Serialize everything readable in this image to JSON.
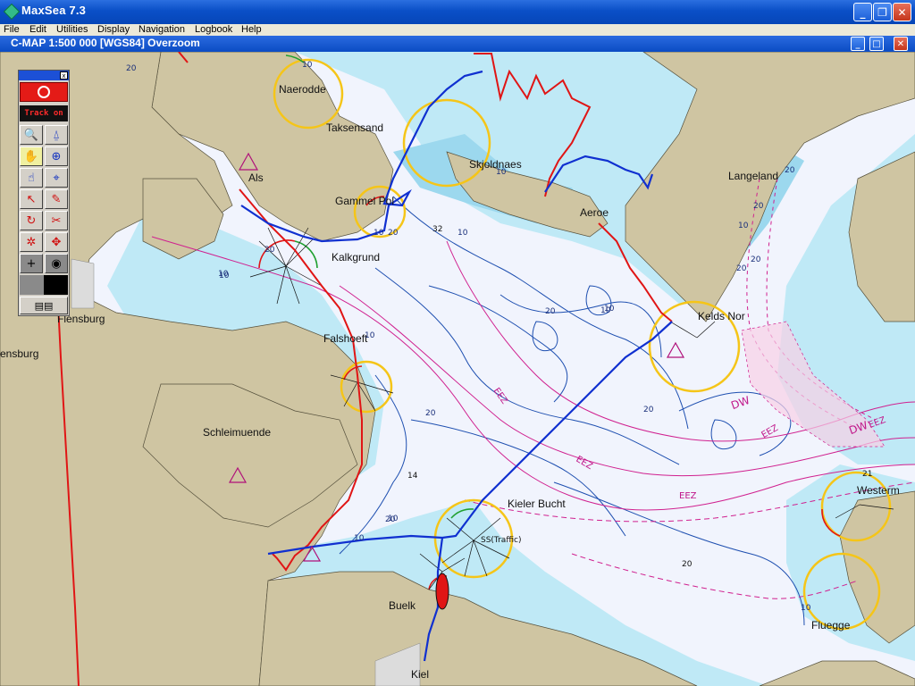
{
  "window": {
    "title": "MaxSea 7.3",
    "buttons": {
      "minimize": "_",
      "maximize": "❐",
      "close": "✕"
    }
  },
  "menu": [
    "File",
    "Edit",
    "Utilities",
    "Display",
    "Navigation",
    "Logbook",
    "Help"
  ],
  "chart_window": {
    "title": "C-MAP  1:500 000 [WGS84]    Overzoom",
    "buttons": {
      "minimize": "_",
      "maximize": "□",
      "close": "✕"
    }
  },
  "places": {
    "naerodde": "Naerodde",
    "taksensand": "Taksensand",
    "skjoldnaes": "Skjoldnaes",
    "als": "Als",
    "gammel_pol": "Gammel Pol",
    "aeroe": "Aeroe",
    "langeland": "Langeland",
    "kalkgrund": "Kalkgrund",
    "flensburg": "Flensburg",
    "flensburg_2": "ensburg",
    "falshoeft": "Falshoeft",
    "keldsnor": "Kelds Nor",
    "schleimuende": "Schleimuende",
    "kieler_bucht": "Kieler Bucht",
    "westermarkelsdorf": "Westerm",
    "buelk": "Buelk",
    "fluegge": "Fluegge",
    "kiel": "Kiel",
    "traffic": "SS(Traffic)"
  },
  "depths": [
    "20",
    "10",
    "10",
    "10",
    "20",
    "32",
    "10",
    "20",
    "20",
    "10",
    "20",
    "10",
    "20",
    "10",
    "20",
    "20",
    "10",
    "20",
    "10",
    "14",
    "20",
    "10",
    "10",
    "20",
    "10",
    "20",
    "21",
    "10"
  ],
  "zones": {
    "eez1": "EEZ",
    "eez2": "EEZ",
    "eez3": "EEZ",
    "eez4": "EEZ",
    "eez5": "EEZ",
    "dw1": "DW",
    "dw2": "DW"
  },
  "toolbox": {
    "close": "x",
    "track_label": "Track on",
    "tools": [
      {
        "name": "zoom-tool",
        "icon": "zoom-icon",
        "glyph": "🔍"
      },
      {
        "name": "compass-tool",
        "icon": "compass-icon",
        "glyph": "⍙"
      },
      {
        "name": "hand-tool",
        "icon": "hand-icon",
        "glyph": "✋"
      },
      {
        "name": "crosshair-tool",
        "icon": "crosshair-icon",
        "glyph": "⊕"
      },
      {
        "name": "pan-tool",
        "icon": "pan-icon",
        "glyph": "☝"
      },
      {
        "name": "route-tool",
        "icon": "route-icon",
        "glyph": "⌖"
      },
      {
        "name": "select-tool",
        "icon": "arrow-icon",
        "glyph": "↖"
      },
      {
        "name": "pencil-tool",
        "icon": "pencil-icon",
        "glyph": "✎"
      },
      {
        "name": "rotate-tool",
        "icon": "rotate-icon",
        "glyph": "↻"
      },
      {
        "name": "cut-tool",
        "icon": "scissors-icon",
        "glyph": "✂"
      },
      {
        "name": "mark-tool",
        "icon": "mark-icon",
        "glyph": "✲"
      },
      {
        "name": "move-tool",
        "icon": "move-icon",
        "glyph": "✥"
      },
      {
        "name": "plus-tool",
        "icon": "plus-icon",
        "glyph": "+"
      },
      {
        "name": "target-tool",
        "icon": "target-icon",
        "glyph": "◉"
      }
    ],
    "bottom_glyph": "▤▤"
  },
  "colors": {
    "land": "#cfc5a2",
    "deep_water": "#f1f4fd",
    "shallow_water": "#bfe9f6",
    "very_shallow": "#9cd8ee",
    "depth_contour": "#1e4fb0",
    "zone_line": "#d0208f",
    "track_blue": "#1030d0",
    "track_red": "#e01515",
    "light_circle": "#f5c518"
  }
}
